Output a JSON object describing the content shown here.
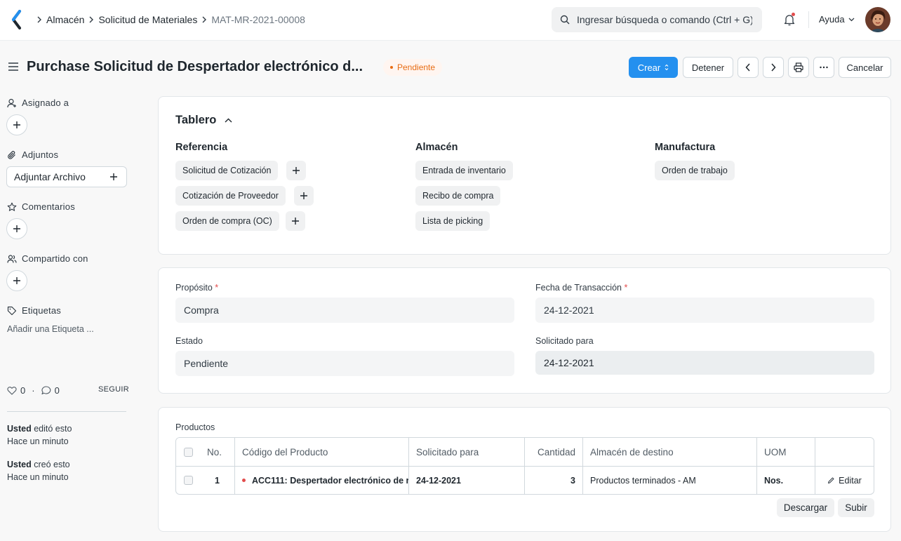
{
  "navbar": {
    "breadcrumbs": [
      "Almacén",
      "Solicitud de Materiales",
      "MAT-MR-2021-00008"
    ],
    "search_placeholder": "Ingresar búsqueda o comando (Ctrl + G)",
    "help_label": "Ayuda"
  },
  "page": {
    "title": "Purchase Solicitud de Despertador electrónico d...",
    "status": "Pendiente",
    "status_color": "#e86c13",
    "buttons": {
      "create": "Crear",
      "stop": "Detener",
      "cancel": "Cancelar"
    }
  },
  "sidebar": {
    "assigned": "Asignado a",
    "attachments": "Adjuntos",
    "attach_file": "Adjuntar Archivo",
    "comments": "Comentarios",
    "shared": "Compartido con",
    "tags": "Etiquetas",
    "add_tag": "Añadir una Etiqueta ...",
    "likes": "0",
    "comment_count": "0",
    "follow": "SEGUIR",
    "activity": [
      {
        "user": "Usted",
        "action": "editó esto",
        "time": "Hace un minuto"
      },
      {
        "user": "Usted",
        "action": "creó esto",
        "time": "Hace un minuto"
      }
    ]
  },
  "dashboard": {
    "title": "Tablero",
    "columns": [
      {
        "title": "Referencia",
        "items": [
          "Solicitud de Cotización",
          "Cotización de Proveedor",
          "Orden de compra (OC)"
        ]
      },
      {
        "title": "Almacén",
        "items": [
          "Entrada de inventario",
          "Recibo de compra",
          "Lista de picking"
        ]
      },
      {
        "title": "Manufactura",
        "items": [
          "Orden de trabajo"
        ]
      }
    ]
  },
  "form": {
    "purpose_label": "Propósito",
    "purpose": "Compra",
    "date_label": "Fecha de Transacción",
    "date": "24-12-2021",
    "state_label": "Estado",
    "state": "Pendiente",
    "required_by_label": "Solicitado para",
    "required_by": "24-12-2021"
  },
  "items": {
    "label": "Productos",
    "headers": [
      "No.",
      "Código del Producto",
      "Solicitado para",
      "Cantidad",
      "Almacén de destino",
      "UOM"
    ],
    "rows": [
      {
        "no": "1",
        "item_code": "ACC111: Despertador electrónico de r",
        "required_by": "24-12-2021",
        "qty": "3",
        "warehouse": "Productos terminados - AM",
        "uom": "Nos.",
        "edit": "Editar"
      }
    ],
    "download": "Descargar",
    "upload": "Subir"
  }
}
